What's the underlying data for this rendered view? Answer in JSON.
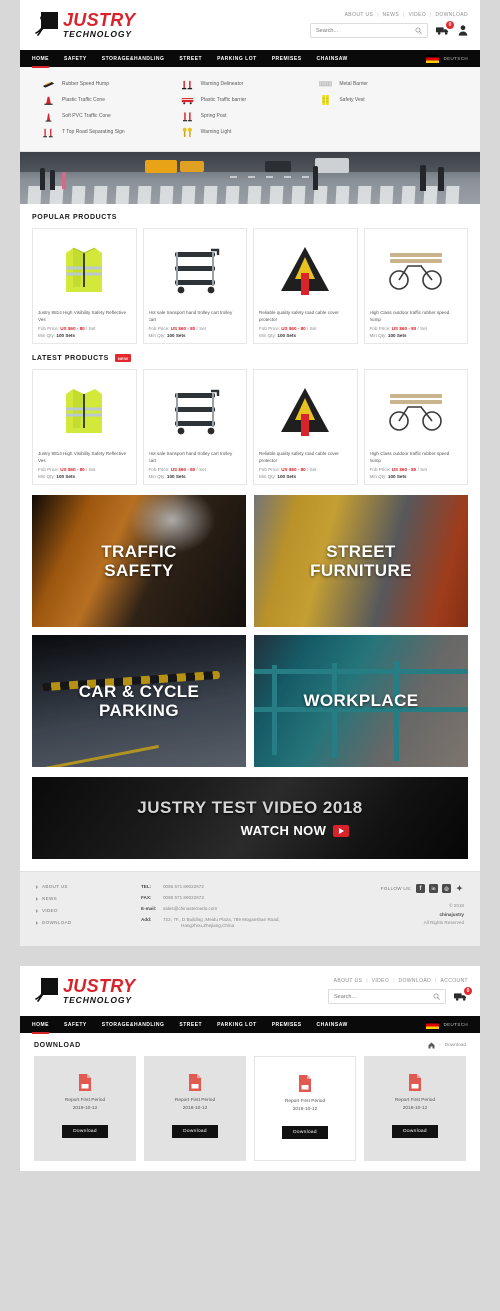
{
  "brand": {
    "name": "JUSTRY",
    "sub": "TECHNOLOGY",
    "accent": "#d8232a"
  },
  "page1": {
    "toplinks": [
      "ABOUT US",
      "NEWS",
      "VIDEO",
      "DOWNLOAD"
    ],
    "search": {
      "placeholder": "Search...",
      "value": ""
    },
    "cart_count": "0",
    "nav": [
      "HOME",
      "SAFETY",
      "STORAGE&HANDLING",
      "STREET",
      "PARKING LOT",
      "PREMISES",
      "CHAINSAW"
    ],
    "lang": "DEUTSCH",
    "mega": {
      "col1": [
        "Rubber Speed Hump",
        "Plastic Traffic Cone",
        "Soft PVC Traffic Cone",
        "T Top Road Separating Sign"
      ],
      "col2": [
        "Warning Delineator",
        "Plastic Traffic barrier",
        "Spring Post",
        "Warning Light"
      ],
      "col3": [
        "Metal Barrier",
        "Safety Vest"
      ]
    },
    "popular": {
      "title": "POPULAR PRODUCTS"
    },
    "latest": {
      "title": "LATEST PRODUCTS",
      "badge": "NEW"
    },
    "products": [
      {
        "title": "Justry 8814 High Visibility Safety Reflective Ves",
        "price_label": "Fob Price:",
        "price": "US $60 - 80",
        "unit": "/ Set",
        "qty_label": "Min Qty:",
        "qty": "100 Sets"
      },
      {
        "title": "Hot sale transport hand trolley cart trolley cart",
        "price_label": "Fob Price:",
        "price": "US $60 - 80",
        "unit": "/ Set",
        "qty_label": "Min Qty:",
        "qty": "100 Sets"
      },
      {
        "title": "Reliable quality safety road cable cover protector",
        "price_label": "Fob Price:",
        "price": "US $60 - 80",
        "unit": "/ Set",
        "qty_label": "Min Qty:",
        "qty": "100 Sets"
      },
      {
        "title": "High Class outdoor traffic rubber speed hump",
        "price_label": "Fob Price:",
        "price": "US $60 - 80",
        "unit": "/ Set",
        "qty_label": "Min Qty:",
        "qty": "100 Sets"
      }
    ],
    "categories": [
      {
        "label": "TRAFFIC\nSAFETY"
      },
      {
        "label": "STREET\nFURNITURE"
      },
      {
        "label": "CAR & CYCLE\nPARKING"
      },
      {
        "label": "WORKPLACE"
      }
    ],
    "video": {
      "title": "JUSTRY TEST VIDEO 2018",
      "cta": "WATCH NOW"
    },
    "footer": {
      "links": [
        "ABOUT US",
        "NEWS",
        "VIDEO",
        "DOWNLOAD"
      ],
      "tel_label": "TEL:",
      "tel": "0086 571 89022672",
      "fax_label": "FAX:",
      "fax": "0086 571 89022673",
      "email_label": "E-mail:",
      "email": "sales@chinasternedo.com",
      "add_label": "Add:",
      "add": "722, 7F., D Building ,Meidu Plaza, 789 Moganshan Road,",
      "add2": "Hangzhou,Zhejiang,China",
      "follow": "FOLLOW US:",
      "social": [
        "f",
        "in",
        "ig",
        "tw"
      ],
      "copy1": "© 2018",
      "copy2": "chinajustry",
      "copy3": "All Rights Reserved"
    }
  },
  "page2": {
    "toplinks": [
      "ABOUT US",
      "VIDEO",
      "DOWNLOAD",
      "ACCOUNT"
    ],
    "search": {
      "placeholder": "Search...",
      "value": ""
    },
    "cart_count": "0",
    "nav": [
      "HOME",
      "SAFETY",
      "STORAGE&HANDLING",
      "STREET",
      "PARKING LOT",
      "PREMISES",
      "CHAINSAW"
    ],
    "lang": "DEUTSCH",
    "title": "DOWNLOAD",
    "breadcrumb": {
      "home_icon": "home-icon",
      "sep": "›",
      "current": "Download"
    },
    "downloads": [
      {
        "name": "Report First Period",
        "date": "2018-10-12",
        "button": "Download",
        "state": "normal"
      },
      {
        "name": "Report First Period",
        "date": "2018-10-12",
        "button": "Download",
        "state": "normal"
      },
      {
        "name": "Report First Period",
        "date": "2018-10-12",
        "button": "Download",
        "state": "hover"
      },
      {
        "name": "Report First Period",
        "date": "2018-10-12",
        "button": "Download",
        "state": "normal"
      }
    ]
  }
}
